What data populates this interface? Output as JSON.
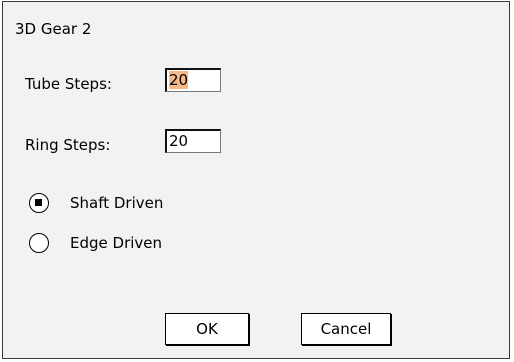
{
  "window": {
    "title": "3D Gear 2"
  },
  "fields": {
    "tube_steps": {
      "label": "Tube Steps:",
      "value": "20"
    },
    "ring_steps": {
      "label": "Ring Steps:",
      "value": "20"
    }
  },
  "drive_mode": {
    "options": [
      {
        "label": "Shaft Driven",
        "selected": true
      },
      {
        "label": "Edge Driven",
        "selected": false
      }
    ]
  },
  "buttons": {
    "ok_label": "OK",
    "cancel_label": "Cancel"
  },
  "colors": {
    "selection_highlight": "#f5b98a",
    "dialog_background": "#f2f2f2"
  }
}
